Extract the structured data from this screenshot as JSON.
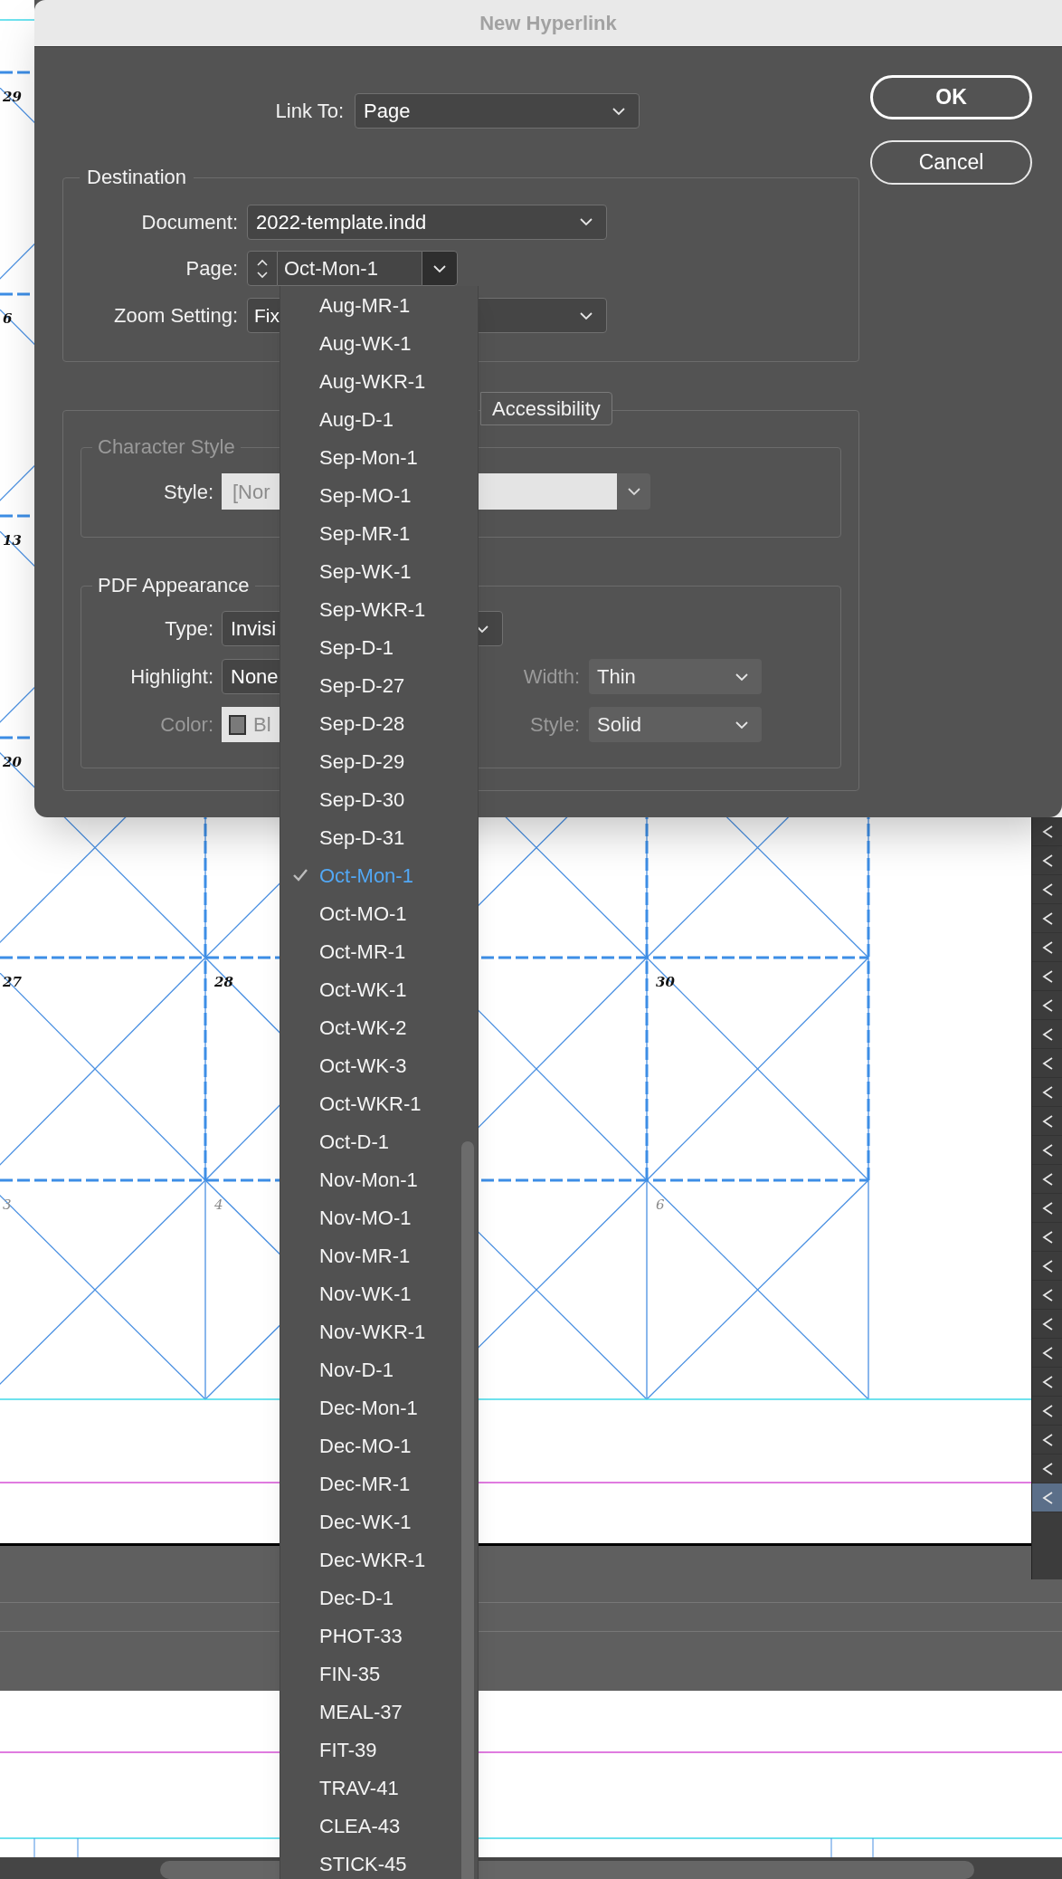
{
  "window": {
    "title": "New Hyperlink"
  },
  "link_to": {
    "label": "Link To:",
    "value": "Page"
  },
  "buttons": [
    {
      "label": "OK",
      "default": true
    },
    {
      "label": "Cancel",
      "default": false
    }
  ],
  "destination": {
    "title": "Destination",
    "document": {
      "label": "Document:",
      "value": "2022-template.indd"
    },
    "page": {
      "label": "Page:",
      "value": "Oct-Mon-1"
    },
    "zoom_setting": {
      "label": "Zoom Setting:",
      "value": "Fix"
    }
  },
  "tabs": [
    {
      "label": "Accessibility",
      "selected": false
    }
  ],
  "character_style": {
    "title": "Character Style",
    "disabled": true,
    "style": {
      "label": "Style:",
      "value": "[Nor"
    }
  },
  "pdf_appearance": {
    "title": "PDF Appearance",
    "type": {
      "label": "Type:",
      "value": "Invisi",
      "disabled": false
    },
    "highlight": {
      "label": "Highlight:",
      "value": "None",
      "disabled": false
    },
    "width": {
      "label": "Width:",
      "value": "Thin",
      "disabled": true
    },
    "color": {
      "label": "Color:",
      "value": "Bl",
      "disabled": true
    },
    "style": {
      "label": "Style:",
      "value": "Solid",
      "disabled": true
    }
  },
  "page_menu": {
    "items": [
      {
        "label": "Aug-MR-1",
        "selected": false
      },
      {
        "label": "Aug-WK-1",
        "selected": false
      },
      {
        "label": "Aug-WKR-1",
        "selected": false
      },
      {
        "label": "Aug-D-1",
        "selected": false
      },
      {
        "label": "Sep-Mon-1",
        "selected": false
      },
      {
        "label": "Sep-MO-1",
        "selected": false
      },
      {
        "label": "Sep-MR-1",
        "selected": false
      },
      {
        "label": "Sep-WK-1",
        "selected": false
      },
      {
        "label": "Sep-WKR-1",
        "selected": false
      },
      {
        "label": "Sep-D-1",
        "selected": false
      },
      {
        "label": "Sep-D-27",
        "selected": false
      },
      {
        "label": "Sep-D-28",
        "selected": false
      },
      {
        "label": "Sep-D-29",
        "selected": false
      },
      {
        "label": "Sep-D-30",
        "selected": false
      },
      {
        "label": "Sep-D-31",
        "selected": false
      },
      {
        "label": "Oct-Mon-1",
        "selected": true
      },
      {
        "label": "Oct-MO-1",
        "selected": false
      },
      {
        "label": "Oct-MR-1",
        "selected": false
      },
      {
        "label": "Oct-WK-1",
        "selected": false
      },
      {
        "label": "Oct-WK-2",
        "selected": false
      },
      {
        "label": "Oct-WK-3",
        "selected": false
      },
      {
        "label": "Oct-WKR-1",
        "selected": false
      },
      {
        "label": "Oct-D-1",
        "selected": false
      },
      {
        "label": "Nov-Mon-1",
        "selected": false
      },
      {
        "label": "Nov-MO-1",
        "selected": false
      },
      {
        "label": "Nov-MR-1",
        "selected": false
      },
      {
        "label": "Nov-WK-1",
        "selected": false
      },
      {
        "label": "Nov-WKR-1",
        "selected": false
      },
      {
        "label": "Nov-D-1",
        "selected": false
      },
      {
        "label": "Dec-Mon-1",
        "selected": false
      },
      {
        "label": "Dec-MO-1",
        "selected": false
      },
      {
        "label": "Dec-MR-1",
        "selected": false
      },
      {
        "label": "Dec-WK-1",
        "selected": false
      },
      {
        "label": "Dec-WKR-1",
        "selected": false
      },
      {
        "label": "Dec-D-1",
        "selected": false
      },
      {
        "label": "PHOT-33",
        "selected": false
      },
      {
        "label": "FIN-35",
        "selected": false
      },
      {
        "label": "MEAL-37",
        "selected": false
      },
      {
        "label": "FIT-39",
        "selected": false
      },
      {
        "label": "TRAV-41",
        "selected": false
      },
      {
        "label": "CLEA-43",
        "selected": false
      },
      {
        "label": "STICK-45",
        "selected": false
      }
    ]
  },
  "calendar": {
    "column_1": [
      {
        "date": "29",
        "muted": false
      },
      {
        "date": "6",
        "muted": false
      },
      {
        "date": "13",
        "muted": false
      },
      {
        "date": "20",
        "muted": false
      },
      {
        "date": "27",
        "muted": false
      },
      {
        "date": "3",
        "muted": true
      }
    ],
    "column_2": [
      {
        "date": "28",
        "muted": false
      },
      {
        "date": "4",
        "muted": true
      }
    ],
    "column_4": [
      {
        "date": "30",
        "muted": false
      },
      {
        "date": "6",
        "muted": true
      }
    ]
  },
  "side_panel": {
    "rows": [
      {
        "selected": false
      },
      {
        "selected": false
      },
      {
        "selected": false
      },
      {
        "selected": false
      },
      {
        "selected": false
      },
      {
        "selected": false
      },
      {
        "selected": false
      },
      {
        "selected": false
      },
      {
        "selected": false
      },
      {
        "selected": false
      },
      {
        "selected": false
      },
      {
        "selected": false
      },
      {
        "selected": false
      },
      {
        "selected": false
      },
      {
        "selected": false
      },
      {
        "selected": false
      },
      {
        "selected": false
      },
      {
        "selected": false
      },
      {
        "selected": false
      },
      {
        "selected": false
      },
      {
        "selected": false
      },
      {
        "selected": false
      },
      {
        "selected": false
      },
      {
        "selected": true
      }
    ]
  }
}
